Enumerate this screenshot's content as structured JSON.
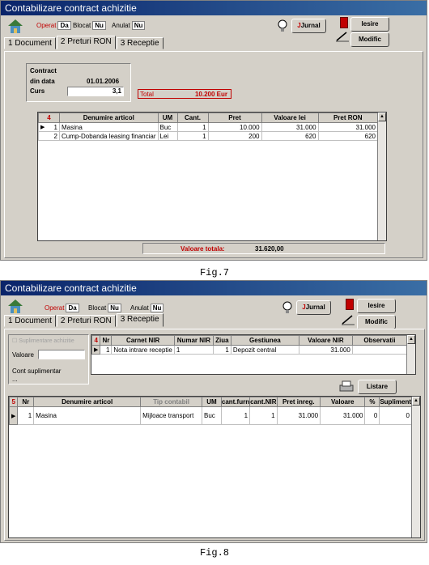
{
  "w1": {
    "title": "Contabilizare contract achizitie",
    "flags": [
      {
        "label": "Operat",
        "value": "Da"
      },
      {
        "label": "Blocat",
        "value": "Nu"
      },
      {
        "label": "Anulat",
        "value": "Nu"
      }
    ],
    "jurnal": "Jurnal",
    "iesire": "Iesire",
    "modific": "Modific",
    "tabs": [
      "1 Document",
      "2 Preturi RON",
      "3 Receptie"
    ],
    "contract_label": "Contract",
    "din_data_label": "din data",
    "din_data_value": "01.01.2006",
    "curs_label": "Curs",
    "curs_value": "3,1",
    "total_label": "Total",
    "total_value": "10.200 Eur",
    "grid_count": "4",
    "columns": [
      "Denumire articol",
      "UM",
      "Cant.",
      "Pret",
      "Valoare lei",
      "Pret RON"
    ],
    "rows": [
      [
        "1",
        "Masina",
        "Buc",
        "1",
        "10.000",
        "31.000",
        "31.000"
      ],
      [
        "2",
        "Cump-Dobanda leasing financiar",
        "Lei",
        "1",
        "200",
        "620",
        "620"
      ]
    ],
    "valoare_totala_label": "Valoare totala:",
    "valoare_totala_value": "31.620,00"
  },
  "caption1": "Fig.7",
  "w2": {
    "title": "Contabilizare contract achizitie",
    "flags": [
      {
        "label": "Operat",
        "value": "Da"
      },
      {
        "label": "Blocat",
        "value": "Nu"
      },
      {
        "label": "Anulat",
        "value": "Nu"
      }
    ],
    "jurnal": "Jurnal",
    "iesire": "Iesire",
    "modific": "Modific",
    "tabs": [
      "1 Document",
      "2 Preturi RON",
      "3 Receptie"
    ],
    "suplim_label": "Suplimentare achizitie",
    "valoare_label": "Valoare",
    "cont_label": "Cont suplimentar",
    "cont_value": "...",
    "top_count": "4",
    "top_columns": [
      "Nr",
      "Carnet NIR",
      "Numar NIR",
      "Ziua",
      "Gestiunea",
      "Valoare NIR",
      "Observatii"
    ],
    "top_rows": [
      [
        "1",
        "Nota intrare receptie",
        "1",
        "1",
        "Depozit central",
        "31.000",
        ""
      ]
    ],
    "listare": "Listare",
    "bot_count": "5",
    "bot_columns": [
      "Nr",
      "Denumire articol",
      "Tip contabil",
      "UM",
      "cant.furn",
      "cant.NIR",
      "Pret inreg.",
      "Valoare",
      "%",
      "Supliment"
    ],
    "bot_rows": [
      [
        "1",
        "Masina",
        "Mijloace transport",
        "Buc",
        "1",
        "1",
        "31.000",
        "31.000",
        "0",
        "0"
      ]
    ]
  },
  "caption2": "Fig.8"
}
